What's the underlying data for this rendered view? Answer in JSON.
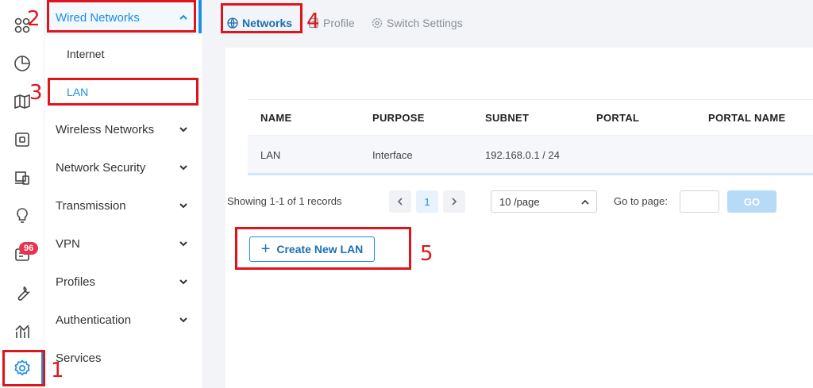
{
  "rail": {
    "icons": [
      "apps-icon",
      "pie-chart-icon",
      "map-icon",
      "device-icon",
      "clients-icon",
      "insight-bulb-icon",
      "log-icon",
      "tools-wrench-icon",
      "statistics-icon",
      "settings-gear-icon"
    ],
    "badge_count": "96"
  },
  "menu": {
    "wired": "Wired Networks",
    "internet": "Internet",
    "lan": "LAN",
    "wireless": "Wireless Networks",
    "security": "Network Security",
    "transmission": "Transmission",
    "vpn": "VPN",
    "profiles": "Profiles",
    "authentication": "Authentication",
    "services": "Services"
  },
  "tabs": {
    "networks": "Networks",
    "profile": "Profile",
    "switch_settings": "Switch Settings"
  },
  "table": {
    "headers": [
      "NAME",
      "PURPOSE",
      "SUBNET",
      "PORTAL",
      "PORTAL NAME"
    ],
    "rows": [
      [
        "LAN",
        "Interface",
        "192.168.0.1 / 24",
        "",
        ""
      ]
    ]
  },
  "pager": {
    "summary": "Showing 1-1 of 1 records",
    "current_page": "1",
    "page_size": "10 /page",
    "goto_label": "Go to page:",
    "go": "GO"
  },
  "create_button": "Create New LAN",
  "annotations": [
    "1",
    "2",
    "3",
    "4",
    "5"
  ],
  "colors": {
    "accent": "#1a8fe3",
    "annotation": "#e0141d",
    "badge": "#e8344e"
  }
}
